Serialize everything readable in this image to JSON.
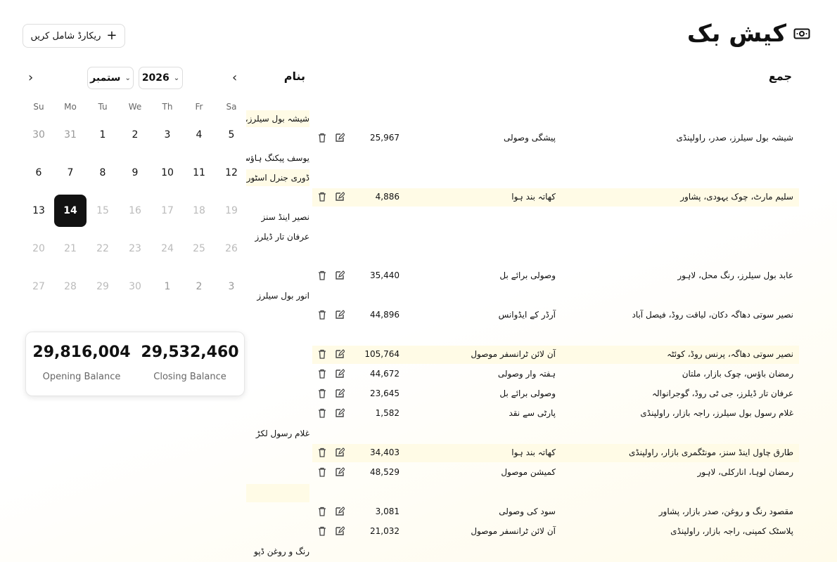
{
  "header": {
    "title": "کیش بک",
    "add_button_label": "ریکارڈ شامل کریں"
  },
  "calendar": {
    "year": "2026",
    "month": "ستمبر",
    "weekdays": [
      "Su",
      "Mo",
      "Tu",
      "We",
      "Th",
      "Fr",
      "Sa"
    ],
    "weeks": [
      [
        "30",
        "31",
        "1",
        "2",
        "3",
        "4",
        "5"
      ],
      [
        "6",
        "7",
        "8",
        "9",
        "10",
        "11",
        "12"
      ],
      [
        "13",
        "14",
        "15",
        "16",
        "17",
        "18",
        "19"
      ],
      [
        "20",
        "21",
        "22",
        "23",
        "24",
        "25",
        "26"
      ],
      [
        "27",
        "28",
        "29",
        "30",
        "1",
        "2",
        "3"
      ]
    ],
    "selected_day": "14"
  },
  "balance": {
    "opening_value": "29,816,004",
    "opening_label": "Opening Balance",
    "closing_value": "29,532,460",
    "closing_label": "Closing Balance"
  },
  "columns": {
    "credit": "جمع",
    "debit": "بنام"
  },
  "debit_entries": [
    "شیشہ بول سیلرز، صدر",
    "یوسف پیکنگ ہاؤس",
    "ڈوری جنرل اسٹور",
    "نصیر اینڈ سنز",
    "عرفان تار ڈیلرز",
    "انور بول سیلرز",
    "غلام رسول لکڑ",
    "رنگ و روغن ڈپو"
  ],
  "credit_rows": [
    {
      "party": "شیشہ بول سیلرز، صدر، راولپنڈی",
      "description": "پیشگی وصولی",
      "amount": "25,967"
    },
    {
      "party": "سلیم مارٹ، چوک یہودی، پشاور",
      "description": "کھاتہ بند ہوا",
      "amount": "4,886"
    },
    {
      "party": "عابد بول سیلرز، رنگ محل، لاہور",
      "description": "وصولی برائے بل",
      "amount": "35,440"
    },
    {
      "party": "نصیر سوتی دھاگہ دکان، لیاقت روڈ، فیصل آباد",
      "description": "آرڈر کے ایڈوانس",
      "amount": "44,896"
    },
    {
      "party": "نصیر سوتی دھاگہ، پرنس روڈ، کوئٹہ",
      "description": "آن لائن ٹرانسفر موصول",
      "amount": "105,764"
    },
    {
      "party": "رمضان باؤس، چوک بازار، ملتان",
      "description": "ہفتہ وار وصولی",
      "amount": "44,672"
    },
    {
      "party": "عرفان تار ڈیلرز، جی ٹی روڈ، گوجرانوالہ",
      "description": "وصولی برائے بل",
      "amount": "23,645"
    },
    {
      "party": "غلام رسول بول سیلرز، راجہ بازار، راولپنڈی",
      "description": "پارٹی سے نقد",
      "amount": "1,582"
    },
    {
      "party": "طارق چاول اینڈ سنز، مونٹگمری بازار، راولپنڈی",
      "description": "کھاتہ بند ہوا",
      "amount": "34,403"
    },
    {
      "party": "رمضان لوہا، انارکلی، لاہور",
      "description": "کمیشن موصول",
      "amount": "48,529"
    },
    {
      "party": "مقصود رنگ و روغن، صدر بازار، پشاور",
      "description": "سود کی وصولی",
      "amount": "3,081"
    },
    {
      "party": "پلاسٹک کمپنی، راجہ بازار، راولپنڈی",
      "description": "آن لائن ٹرانسفر موصول",
      "amount": "21,032"
    }
  ]
}
